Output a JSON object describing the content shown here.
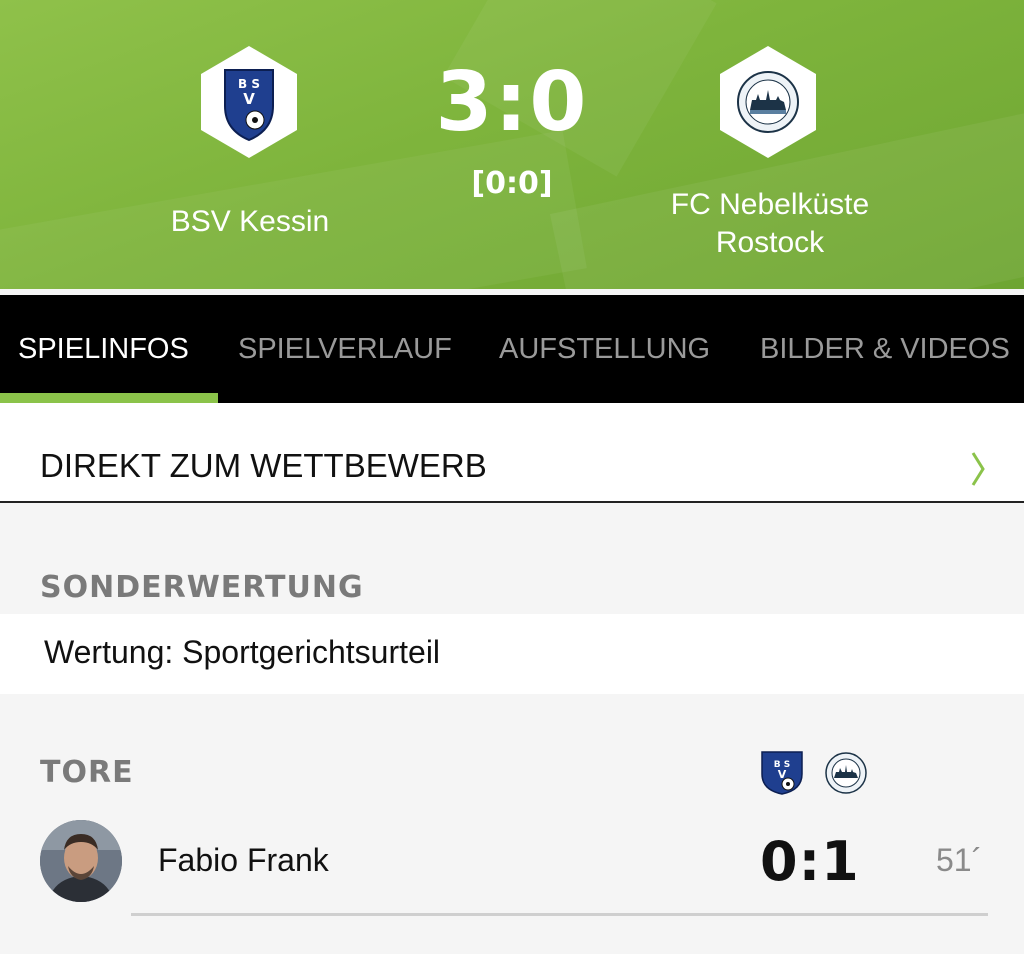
{
  "match": {
    "home_team": "BSV Kessin",
    "away_team_line1": "FC Nebelküste",
    "away_team_line2": "Rostock",
    "score": "3:0",
    "halftime": "[0:0]",
    "home_logo": "bsv-kessin-crest",
    "away_logo": "fc-nebelkueste-rostock-crest"
  },
  "tabs": [
    {
      "label": "SPIELINFOS",
      "active": true
    },
    {
      "label": "SPIELVERLAUF",
      "active": false
    },
    {
      "label": "AUFSTELLUNG",
      "active": false
    },
    {
      "label": "BILDER & VIDEOS",
      "active": false
    }
  ],
  "competition_link": {
    "label": "DIREKT ZUM WETTBEWERB",
    "icon": "chevron-right-icon"
  },
  "special_rating": {
    "heading": "SONDERWERTUNG",
    "text": "Wertung: Sportgerichtsurteil"
  },
  "goals": {
    "heading": "TORE",
    "items": [
      {
        "player": "Fabio Frank",
        "score": "0:1",
        "minute": "51´"
      }
    ]
  },
  "colors": {
    "header_green": "#7eb43c",
    "accent_green": "#8bc34a",
    "tabs_bg": "#000000",
    "crest_blue": "#1f3f8f"
  }
}
